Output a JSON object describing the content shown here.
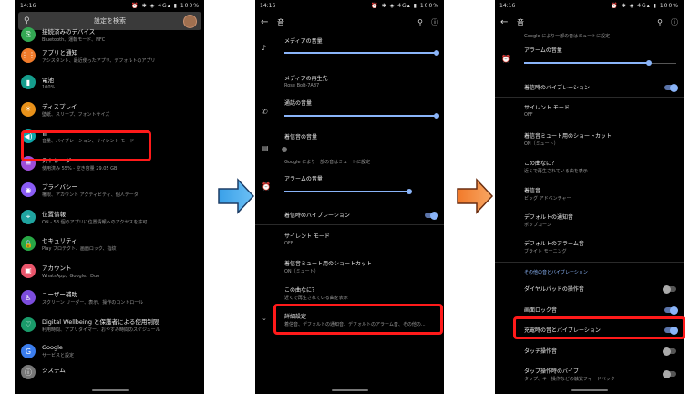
{
  "status": {
    "time": "14:16",
    "icons": "⏰ ✱ ◈ 4G▴ ▮ 100%"
  },
  "screen1": {
    "search_placeholder": "設定を検索",
    "items": [
      {
        "title": "接続済みのデバイス",
        "subtitle": "Bluetooth、運転モード、NFC",
        "color": "#33a853",
        "icon": "device-icon",
        "glyph": "⎘"
      },
      {
        "title": "アプリと通知",
        "subtitle": "アシスタント、最近使ったアプリ、デフォルトのアプリ",
        "color": "#f07b2b",
        "icon": "apps-icon",
        "glyph": "⋮⋮"
      },
      {
        "title": "電池",
        "subtitle": "100%",
        "color": "#159d8c",
        "icon": "battery-icon",
        "glyph": "▮"
      },
      {
        "title": "ディスプレイ",
        "subtitle": "壁紙、スリープ、フォントサイズ",
        "color": "#e8911a",
        "icon": "brightness-icon",
        "glyph": "☀"
      },
      {
        "title": "音",
        "subtitle": "音量、バイブレーション、サイレント モード",
        "color": "#0ea5a8",
        "icon": "volume-icon",
        "glyph": "◀)"
      },
      {
        "title": "ストレージ",
        "subtitle": "使用済み 55% - 空き容量 29.05 GB",
        "color": "#9d4ed8",
        "icon": "storage-icon",
        "glyph": "≡"
      },
      {
        "title": "プライバシー",
        "subtitle": "権限、アカウント アクティビティ、個人データ",
        "color": "#8a5cf5",
        "icon": "privacy-icon",
        "glyph": "◉"
      },
      {
        "title": "位置情報",
        "subtitle": "ON - 53 個のアプリに位置情報へのアクセスを許可",
        "color": "#20a4a0",
        "icon": "location-icon",
        "glyph": "⌖"
      },
      {
        "title": "セキュリティ",
        "subtitle": "Play プロテクト、画面ロック、指紋",
        "color": "#28a745",
        "icon": "lock-icon",
        "glyph": "🔒"
      },
      {
        "title": "アカウント",
        "subtitle": "WhatsApp、Google、Duo",
        "color": "#e9556b",
        "icon": "account-icon",
        "glyph": "▣"
      },
      {
        "title": "ユーザー補助",
        "subtitle": "スクリーン リーダー、表示、操作のコントロール",
        "color": "#7c4ddd",
        "icon": "accessibility-icon",
        "glyph": "♿"
      },
      {
        "title": "Digital Wellbeing と保護者による使用制限",
        "subtitle": "利用時間、アプリタイマー、おやすみ時間のスケジュール",
        "color": "#1a9b6a",
        "icon": "wellbeing-icon",
        "glyph": "♡"
      },
      {
        "title": "Google",
        "subtitle": "サービスと設定",
        "color": "#3b7ded",
        "icon": "google-icon",
        "glyph": "G"
      },
      {
        "title": "システム",
        "subtitle": "",
        "color": "#777777",
        "icon": "system-icon",
        "glyph": "ⓘ"
      }
    ]
  },
  "screen2": {
    "title": "音",
    "media_volume": "メディアの音量",
    "media_output": "メディアの再生先",
    "media_output_device": "Rose Bolt-7A87",
    "call_volume": "通話の音量",
    "ring_volume": "着信音の音量",
    "ring_note": "Google により一部の音はミュートに設定",
    "alarm_volume": "アラームの音量",
    "vibrate_calls": "着信時のバイブレーション",
    "dnd": "サイレント モード",
    "dnd_state": "OFF",
    "mute_shortcut": "着信音ミュート用のショートカット",
    "mute_shortcut_state": "ON（ミュート）",
    "now_playing": "この曲なに？",
    "now_playing_sub": "近くで再生されている曲を表示",
    "advanced": "詳細設定",
    "advanced_sub": "着信音、デフォルトの通知音、デフォルトのアラーム音、その他の..."
  },
  "screen3": {
    "title": "音",
    "ring_note": "Google により一部の音はミュートに設定",
    "alarm_volume": "アラームの音量",
    "vibrate_calls": "着信時のバイブレーション",
    "dnd": "サイレント モード",
    "dnd_state": "OFF",
    "mute_shortcut": "着信音ミュート用のショートカット",
    "mute_shortcut_state": "ON（ミュート）",
    "now_playing": "この曲なに？",
    "now_playing_sub": "近くで再生されている曲を表示",
    "ringtone": "着信音",
    "ringtone_value": "ビッグ アドベンチャー",
    "notif_sound": "デフォルトの通知音",
    "notif_sound_value": "ポップコーン",
    "alarm_sound": "デフォルトのアラーム音",
    "alarm_sound_value": "ブライト モーニング",
    "other_category": "その他の音とバイブレーション",
    "dialpad": "ダイヤルパッドの操作音",
    "screen_lock": "画面ロック音",
    "charging": "充電時の音とバイブレーション",
    "touch": "タッチ操作音",
    "tap_vibe": "タップ操作時のバイブ",
    "tap_vibe_sub": "タップ、キー操作などの触覚フィードバック"
  },
  "arrows": {
    "first_color": "#3aa0e8",
    "second_color": "#f27a2a"
  },
  "highlight_color": "#ff1a1a"
}
